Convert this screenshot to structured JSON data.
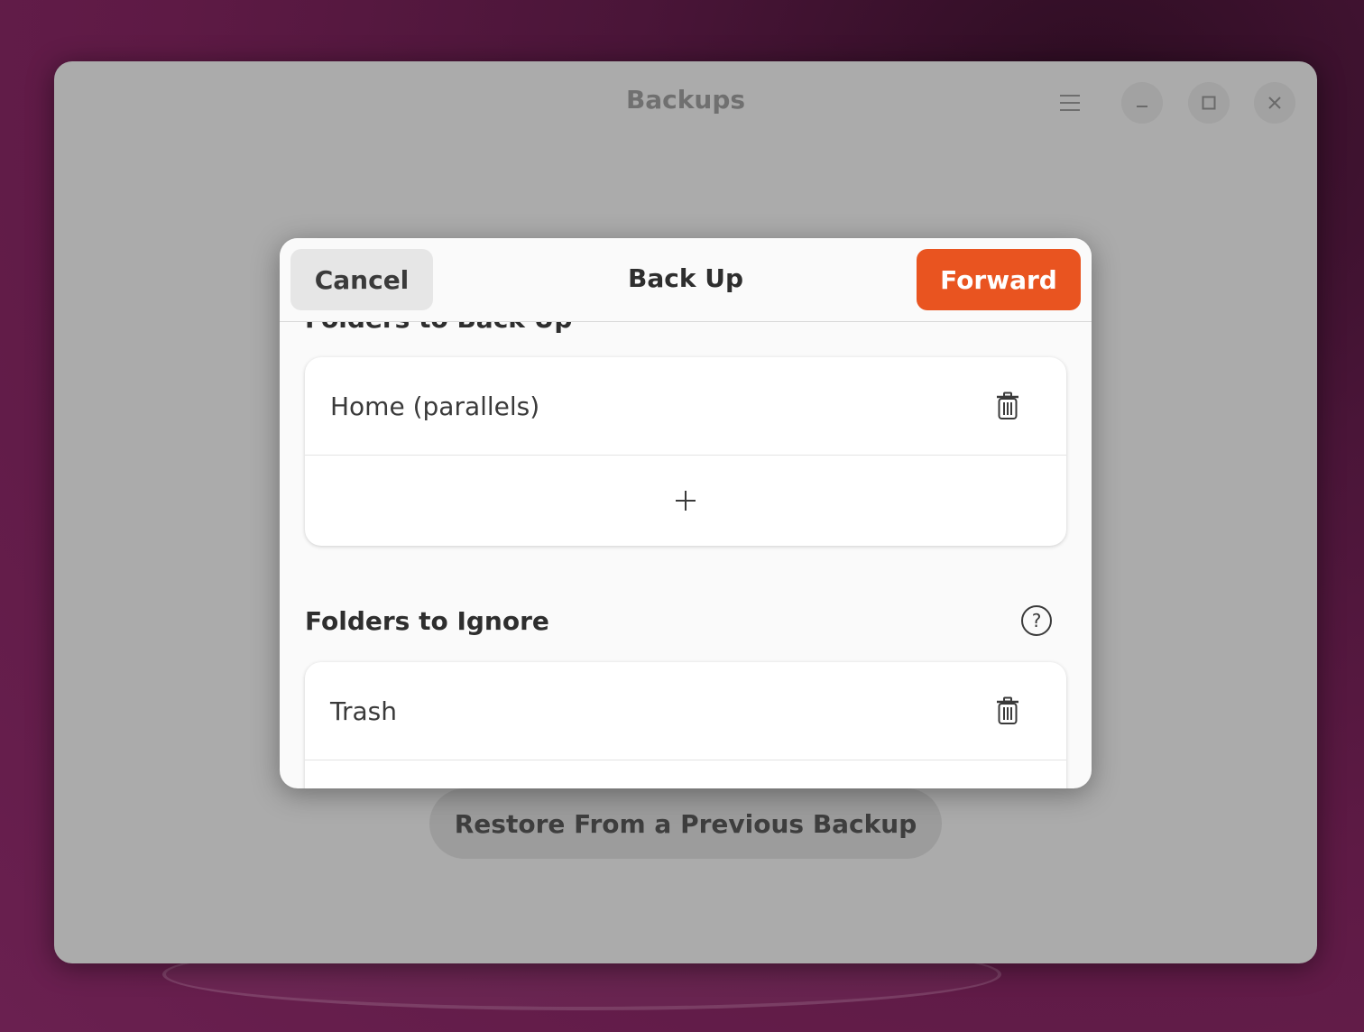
{
  "window": {
    "title": "Backups",
    "restore_label": "Restore From a Previous Backup"
  },
  "dialog": {
    "cancel_label": "Cancel",
    "title": "Back Up",
    "forward_label": "Forward",
    "accent_color": "#e95420",
    "backup_section": {
      "title": "Folders to Back Up",
      "items": [
        {
          "label": "Home (parallels)",
          "icon": "trash-icon"
        }
      ],
      "add_icon": "plus-icon"
    },
    "ignore_section": {
      "title": "Folders to Ignore",
      "help_icon": "help-icon",
      "items": [
        {
          "label": "Trash",
          "icon": "trash-icon"
        }
      ]
    }
  }
}
